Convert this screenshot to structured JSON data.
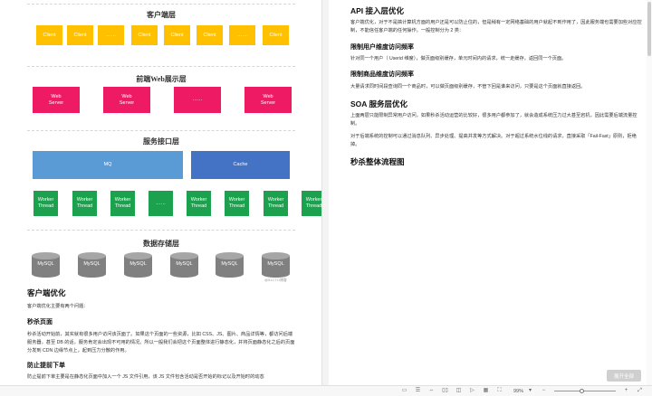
{
  "diagram": {
    "layer1_title": "客户端层",
    "clients": [
      "Client",
      "Client",
      "……",
      "Client",
      "Client",
      "Client",
      "……",
      "Client"
    ],
    "layer2_title": "前端Web展示层",
    "web_servers": [
      "Web\nServer",
      "Web\nServer",
      "……",
      "Web\nServer"
    ],
    "layer3_title": "服务接口层",
    "mq_label": "MQ",
    "cache_label": "Cache",
    "workers": [
      "Worker\nThread",
      "Worker\nThread",
      "Worker\nThread",
      "……",
      "Worker\nThread",
      "Worker\nThread",
      "Worker\nThread",
      "Worker\nThread"
    ],
    "layer4_title": "数据存储层",
    "dbs": [
      "MySQL",
      "MySQL",
      "MySQL",
      "MySQL",
      "MySQL",
      "MySQL"
    ],
    "watermark": "@51CTO博客"
  },
  "left_text": {
    "h_client": "客户端优化",
    "p_client": "客户端优化主要有两个问题：",
    "h_seckill_page": "秒杀页面",
    "p_seckill_page": "秒杀活动开始前，其实就有很多用户访问该页面了。如果这个页面的一些资源，比如 CSS、JS、图片、商品详情等，都访问后端服务器，甚至 DB 的话，服务肯定会出现不可用的情况。所以一般我们会把这个页面整体进行静态化，并将页面静态化之后的页面分发到 CDN 边缘节点上，起到压力分散的作用。",
    "h_prevent": "防止提前下单",
    "p_prevent": "防止提前下单主要是在静态化页面中加入一个 JS 文件引用，该 JS 文件包含活动是否开始的标记以及开始时的动态"
  },
  "right_text": {
    "h_api": "API 接入层优化",
    "p_api": "客户端优化，对于不是搞计算机方面的用户还是可以防止住的，但是稍有一定网络基础的用户就起不到作用了，因此服务端也需要加些对应控制，不能信任客户端的任何操作。一般控制分为 2 类：",
    "h_user": "限制用户维度访问频率",
    "p_user": "针对同一个用户（ Userid 维度），做页面级别缓存，单元时间内的请求，统一走缓存，返回同一个页面。",
    "h_goods": "限制商品维度访问频率",
    "p_goods": "大量请求同时间段查询同一个商品时，可以做页面级别缓存，不管下回是谁来访问，只要是这个页面就直接返回。",
    "h_soa": "SOA 服务层优化",
    "p_soa1": "上面两层只能限制异常用户访问，如果秒杀活动运营的比较好，很多用户都参加了，就会造成系统压力过大甚至宕机，因此需要后端流量控制。",
    "p_soa2": "对于后端系统的控制可以通过消息队列、异步处理、提高并发等方式解决。对于超过系统水位线的请求，直接采取「Fail-Fast」原则，拒绝掉。",
    "h_flow": "秒杀整体流程图"
  },
  "ui": {
    "float_button": "展开全部",
    "zoom_level": "99%",
    "zoom_fraction": 0.45
  }
}
